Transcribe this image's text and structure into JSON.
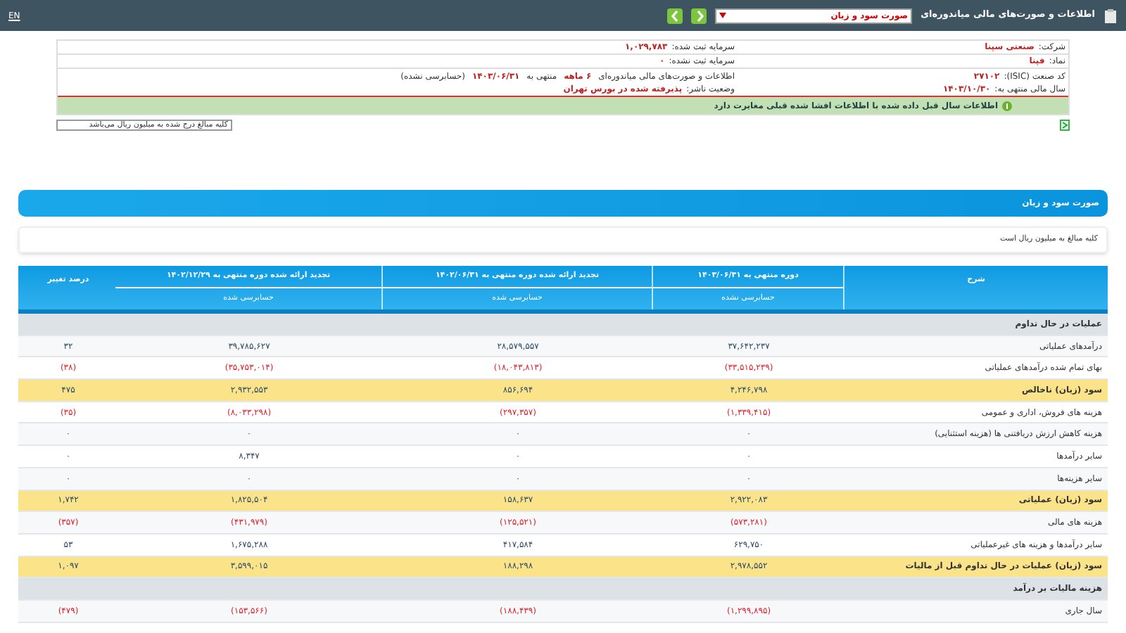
{
  "top_bar": {
    "title": "اطلاعات و صورت‌های مالی میاندوره‌ای",
    "report_select": "صورت سود و زیان",
    "language": "EN"
  },
  "company": {
    "name_label": "شرکت:",
    "name": "صنعتی سپنا",
    "symbol_label": "نماد:",
    "symbol": "فپنا",
    "isic_label": "کد صنعت (ISIC):",
    "isic": "۲۷۱۰۲",
    "fiscal_label": "سال مالی منتهی به:",
    "fiscal": "۱۴۰۳/۱۰/۳۰",
    "capital_label": "سرمایه ثبت شده:",
    "capital": "۱,۰۲۹,۷۸۳",
    "unreg_label": "سرمایه ثبت نشده:",
    "unreg": "۰",
    "report_label": "اطلاعات و صورت‌های مالی میاندوره‌ای",
    "report_period": "۶ ماهه",
    "report_end_label": "منتهی به",
    "report_end": "۱۴۰۳/۰۶/۳۱",
    "report_status": "(حسابرسی نشده)",
    "publisher_label": "وضعیت ناشر:",
    "publisher": "پذیرفته شده در بورس تهران"
  },
  "notice": "اطلاعات سال قبل داده شده با اطلاعات افشا شده قبلی مغایرت دارد",
  "unit_field": "کلیه مبالغ درج شده به میلیون ریال می‌باشد",
  "panel": {
    "title": "صورت سود و زیان",
    "note": "کلیه مبالغ به میلیون ریال است"
  },
  "table": {
    "columns": [
      "شرح",
      "دوره منتهی به ۱۴۰۳/۰۶/۳۱",
      "تجدید ارائه شده دوره منتهی به ۱۴۰۲/۰۶/۳۱",
      "تجدید ارائه شده دوره منتهی به ۱۴۰۲/۱۲/۲۹",
      "درصد تغییر"
    ],
    "subcolumns": [
      "حسابرسی نشده",
      "حسابرسی شده",
      "حسابرسی شده"
    ],
    "rows": [
      {
        "kind": "section",
        "label": "عملیات در حال تداوم"
      },
      {
        "kind": "item",
        "negative": false,
        "label": "درآمدهای عملیاتی",
        "values": [
          "۳۷,۶۴۲,۲۳۷",
          "۲۸,۵۷۹,۵۵۷",
          "۳۹,۷۸۵,۶۲۷",
          "۳۲"
        ]
      },
      {
        "kind": "item",
        "negative": true,
        "label": "بهای تمام شده درآمدهای عملیاتی",
        "values": [
          "(۳۳,۵۱۵,۲۳۹)",
          "(۱۸,۰۴۳,۸۱۳)",
          "(۳۵,۷۵۳,۰۱۴)",
          "(۳۸)"
        ]
      },
      {
        "kind": "total",
        "negative": false,
        "label": "سود (زیان) ناخالص",
        "values": [
          "۴,۲۴۶,۷۹۸",
          "۸۵۶,۶۹۴",
          "۲,۹۳۲,۵۵۳",
          "۴۷۵"
        ]
      },
      {
        "kind": "item",
        "negative": true,
        "label": "هزینه های فروش، اداری و عمومی",
        "values": [
          "(۱,۳۳۹,۴۱۵)",
          "(۲۹۷,۳۵۷)",
          "(۸,۰۳۳,۲۹۸)",
          "(۳۵)"
        ]
      },
      {
        "kind": "item",
        "negative": false,
        "label": "هزینه کاهش ارزش دریافتنی ها (هزینه استثنایی)",
        "values": [
          "۰",
          "۰",
          "۰",
          "۰"
        ]
      },
      {
        "kind": "item",
        "negative": false,
        "label": "سایر درآمدها",
        "values": [
          "۰",
          "۰",
          "۸,۳۴۷",
          "۰"
        ]
      },
      {
        "kind": "item",
        "negative": false,
        "label": "سایر هزینه‌ها",
        "values": [
          "۰",
          "۰",
          "۰",
          "۰"
        ]
      },
      {
        "kind": "total",
        "negative": false,
        "label": "سود (زیان) عملیاتی",
        "values": [
          "۲,۹۲۲,۰۸۳",
          "۱۵۸,۶۳۷",
          "۱,۸۲۵,۵۰۴",
          "۱,۷۴۲"
        ]
      },
      {
        "kind": "item",
        "negative": true,
        "label": "هزینه های مالی",
        "values": [
          "(۵۷۳,۲۸۱)",
          "(۱۲۵,۵۲۱)",
          "(۴۳۱,۹۷۹)",
          "(۳۵۷)"
        ]
      },
      {
        "kind": "item",
        "negative": false,
        "label": "سایر درآمدها و هزینه های غیرعملیاتی",
        "values": [
          "۶۲۹,۷۵۰",
          "۴۱۷,۵۸۴",
          "۱,۶۷۵,۲۸۸",
          "۵۳"
        ]
      },
      {
        "kind": "total",
        "negative": false,
        "label": "سود (زیان) عملیات در حال تداوم قبل از مالیات",
        "values": [
          "۲,۹۷۸,۵۵۲",
          "۱۸۸,۲۹۸",
          "۳,۵۹۹,۰۱۵",
          "۱,۰۹۷"
        ]
      },
      {
        "kind": "section",
        "label": "هزینه مالیات بر درآمد"
      },
      {
        "kind": "item",
        "negative": true,
        "label": "سال جاری",
        "values": [
          "(۱,۲۹۹,۸۹۵)",
          "(۱۸۸,۴۳۹)",
          "(۱۵۳,۵۶۶)",
          "(۴۷۹)"
        ]
      }
    ]
  }
}
